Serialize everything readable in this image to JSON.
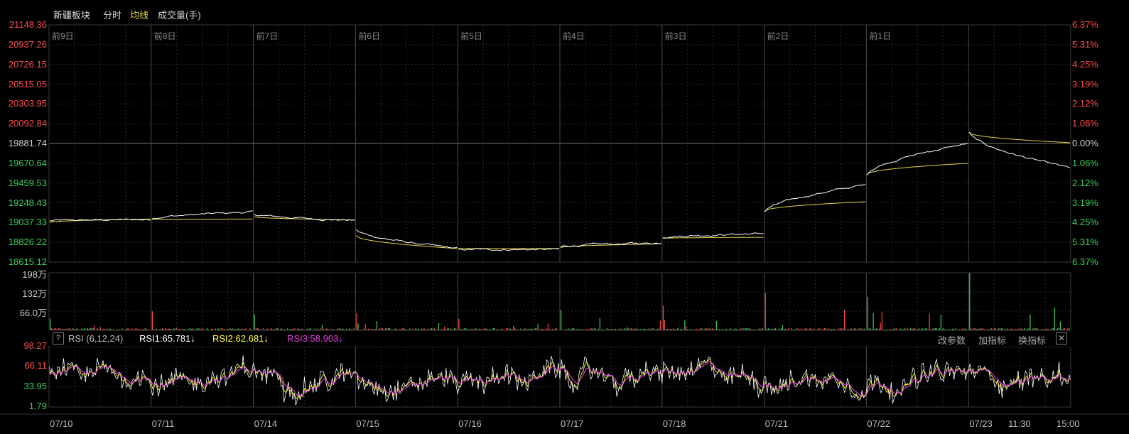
{
  "header": {
    "sector_name": "新疆板块",
    "mode_label": "分时",
    "avg_label": "均线",
    "volume_label": "成交量(手)"
  },
  "price_axis": {
    "left_labels": [
      "21148.36",
      "20937.26",
      "20726.15",
      "20515.05",
      "20303.95",
      "20092.84",
      "19881.74",
      "19670.64",
      "19459.53",
      "19248.43",
      "19037.33",
      "18826.22",
      "18615.12"
    ],
    "right_labels": [
      "6.37%",
      "5.31%",
      "4.25%",
      "3.19%",
      "2.12%",
      "1.06%",
      "0.00%",
      "1.06%",
      "2.12%",
      "3.19%",
      "4.25%",
      "5.31%",
      "6.37%"
    ],
    "base_price": 19881.74,
    "max_price": 21148.36,
    "min_price": 18615.12
  },
  "volume_axis": {
    "labels": [
      "198万",
      "132万",
      "66.0万"
    ],
    "max": 198
  },
  "rsi_panel": {
    "help_label": "?",
    "title": "RSI (6,12,24)",
    "rsi1_text": "RSI1:65.781↓",
    "rsi2_text": "RSI2:62.681↓",
    "rsi3_text": "RSI3:58.903↓",
    "axis_labels": [
      "98.27",
      "66.11",
      "33.95",
      "1.79"
    ],
    "buttons": {
      "change_params": "改参数",
      "add_indicator": "加指标",
      "switch_indicator": "换指标",
      "close": "✕"
    }
  },
  "day_labels": [
    "前9日",
    "前8日",
    "前7日",
    "前6日",
    "前5日",
    "前4日",
    "前3日",
    "前2日",
    "前1日"
  ],
  "date_labels": [
    "07/10",
    "07/11",
    "07/14",
    "07/15",
    "07/16",
    "07/17",
    "07/18",
    "07/21",
    "07/22",
    "07/23",
    "11:30",
    "15:00"
  ],
  "colors": {
    "up": "#ff4a4a",
    "down": "#3fcf5f",
    "price_line": "#ffffff",
    "avg_line": "#e6d94a",
    "rsi1": "#ffffff",
    "rsi2": "#ffff40",
    "rsi3": "#e040e0",
    "grid": "#2a2a2a",
    "day_separator": "#4a4a4a"
  },
  "chart_data": {
    "type": "line",
    "days": [
      "07/10",
      "07/11",
      "07/14",
      "07/15",
      "07/16",
      "07/17",
      "07/18",
      "07/21",
      "07/22",
      "07/23"
    ],
    "price": {
      "ylim": [
        18615.12,
        21148.36
      ],
      "series": [
        {
          "name": "分时",
          "day_open_close": [
            [
              19055,
              19070
            ],
            [
              19080,
              19150
            ],
            [
              19130,
              19060
            ],
            [
              18960,
              18760
            ],
            [
              18750,
              18750
            ],
            [
              18780,
              18820
            ],
            [
              18880,
              18920
            ],
            [
              19150,
              19440
            ],
            [
              19550,
              19880
            ],
            [
              20000,
              19620
            ]
          ]
        },
        {
          "name": "均线",
          "day_open_close": [
            [
              19040,
              19075
            ],
            [
              19070,
              19075
            ],
            [
              19100,
              19065
            ],
            [
              18900,
              18760
            ],
            [
              18760,
              18760
            ],
            [
              18770,
              18810
            ],
            [
              18870,
              18880
            ],
            [
              19160,
              19260
            ],
            [
              19550,
              19670
            ],
            [
              20000,
              19890
            ]
          ]
        }
      ]
    },
    "volume": {
      "ylim": [
        0,
        198
      ],
      "unit": "万",
      "day_peaks": [
        40,
        65,
        55,
        58,
        40,
        70,
        85,
        130,
        115,
        198
      ]
    },
    "rsi": {
      "ylim": [
        1.79,
        98.27
      ],
      "series_names": [
        "RSI1",
        "RSI2",
        "RSI3"
      ],
      "latest": [
        65.781,
        62.681,
        58.903
      ]
    }
  }
}
